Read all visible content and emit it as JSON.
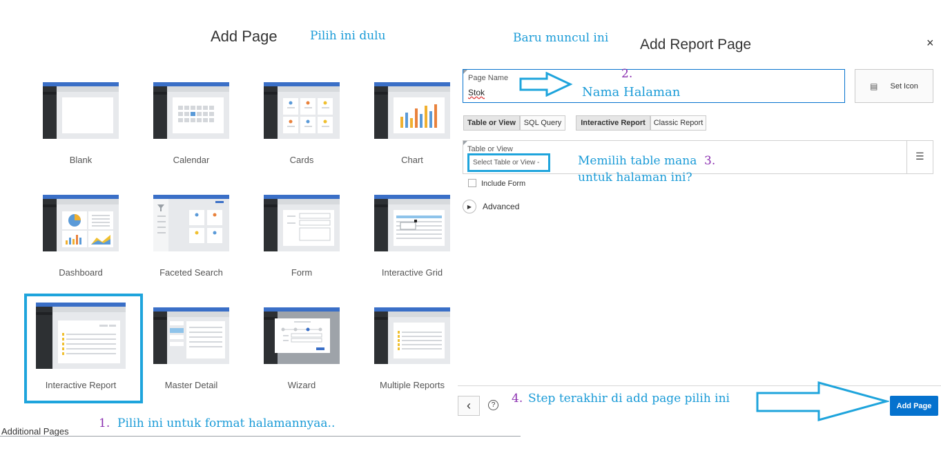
{
  "left": {
    "title": "Add Page",
    "tiles": [
      {
        "label": "Blank",
        "icon": "blank-page-icon"
      },
      {
        "label": "Calendar",
        "icon": "calendar-page-icon"
      },
      {
        "label": "Cards",
        "icon": "cards-page-icon"
      },
      {
        "label": "Chart",
        "icon": "chart-page-icon"
      },
      {
        "label": "Dashboard",
        "icon": "dashboard-page-icon"
      },
      {
        "label": "Faceted Search",
        "icon": "faceted-search-page-icon"
      },
      {
        "label": "Form",
        "icon": "form-page-icon"
      },
      {
        "label": "Interactive Grid",
        "icon": "interactive-grid-page-icon"
      },
      {
        "label": "Interactive Report",
        "icon": "interactive-report-page-icon"
      },
      {
        "label": "Master Detail",
        "icon": "master-detail-page-icon"
      },
      {
        "label": "Wizard",
        "icon": "wizard-page-icon"
      },
      {
        "label": "Multiple Reports",
        "icon": "multiple-reports-page-icon"
      }
    ],
    "selected": "Interactive Report",
    "additional_pages": "Additional Pages"
  },
  "right": {
    "title": "Add Report Page",
    "close": "×",
    "page_name_label": "Page Name",
    "page_name_value": "Stok",
    "set_icon_label": "Set Icon",
    "source_tabs": [
      "Table or View",
      "SQL Query"
    ],
    "report_tabs": [
      "Interactive Report",
      "Classic Report"
    ],
    "table_label": "Table or View",
    "table_placeholder": "Select Table or View -",
    "include_form": "Include Form",
    "advanced": "Advanced",
    "back": "‹",
    "help": "?",
    "add_button": "Add Page"
  },
  "annotations": {
    "pilih_dulu": "Pilih ini dulu",
    "baru_muncul": "Baru muncul ini",
    "n1": "1.",
    "a1": "Pilih ini untuk format halamannyaa..",
    "n2": "2.",
    "a2": "Nama Halaman",
    "n3": "3.",
    "a3_line1": "Memilih table mana",
    "a3_line2": "untuk halaman ini?",
    "n4": "4.",
    "a4": "Step terakhir di add page pilih ini"
  },
  "colors": {
    "accent": "#0572ce",
    "annotation": "#1a9bd7",
    "number": "#8b2fb0",
    "highlight": "#1ea4dc"
  }
}
